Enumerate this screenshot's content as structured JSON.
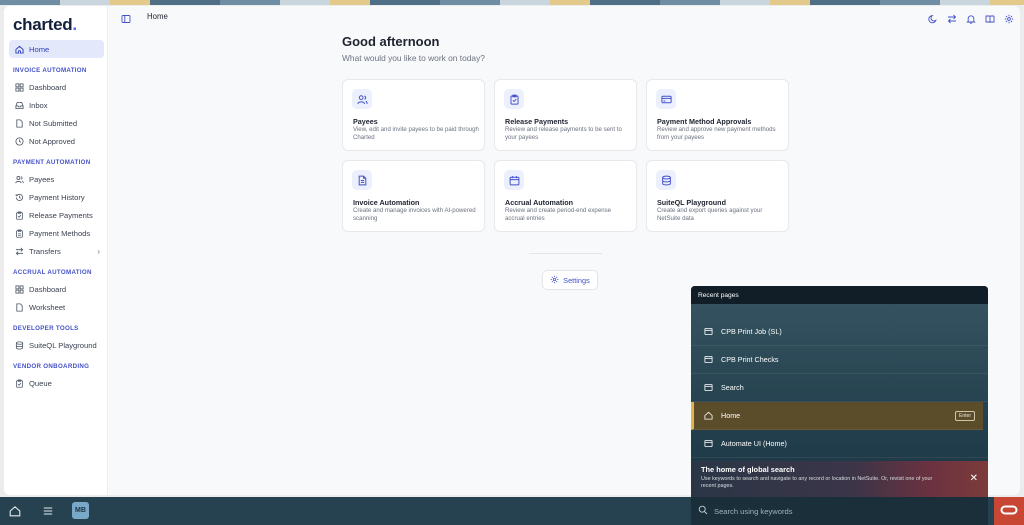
{
  "app": {
    "logo_text": "charted",
    "logo_dot": "."
  },
  "sidebar": {
    "home": "Home",
    "sections": [
      {
        "title": "INVOICE AUTOMATION",
        "items": [
          "Dashboard",
          "Inbox",
          "Not Submitted",
          "Not Approved"
        ]
      },
      {
        "title": "PAYMENT AUTOMATION",
        "items": [
          "Payees",
          "Payment History",
          "Release Payments",
          "Payment Methods",
          "Transfers"
        ]
      },
      {
        "title": "ACCRUAL AUTOMATION",
        "items": [
          "Dashboard",
          "Worksheet"
        ]
      },
      {
        "title": "DEVELOPER TOOLS",
        "items": [
          "SuiteQL Playground"
        ]
      },
      {
        "title": "VENDOR ONBOARDING",
        "items": [
          "Queue"
        ]
      }
    ]
  },
  "topbar": {
    "breadcrumb": "Home"
  },
  "main": {
    "greeting": "Good afternoon",
    "subtitle": "What would you like to work on today?",
    "cards": [
      {
        "title": "Payees",
        "desc": "View, edit and invite payees to be paid through Charted",
        "icon": "users-icon"
      },
      {
        "title": "Release Payments",
        "desc": "Review and release payments to be sent to your payees",
        "icon": "clipboard-check-icon"
      },
      {
        "title": "Payment Method Approvals",
        "desc": "Review and approve new payment methods from your payees",
        "icon": "credit-card-icon"
      },
      {
        "title": "Invoice Automation",
        "desc": "Create and manage invoices with AI-powered scanning",
        "icon": "document-icon"
      },
      {
        "title": "Accrual Automation",
        "desc": "Review and create period-end expense accrual entries",
        "icon": "calendar-icon"
      },
      {
        "title": "SuiteQL Playground",
        "desc": "Create and export queries against your NetSuite data",
        "icon": "database-icon"
      }
    ],
    "settings_label": "Settings"
  },
  "netsuite": {
    "recent_title": "Recent pages",
    "recent": [
      {
        "label": "CPB Print Job (SL)",
        "icon": "page-icon"
      },
      {
        "label": "CPB Print Checks",
        "icon": "page-icon"
      },
      {
        "label": "Search",
        "icon": "page-icon"
      },
      {
        "label": "Home",
        "icon": "home-icon",
        "badge": "Enter"
      },
      {
        "label": "Automate UI (Home)",
        "icon": "page-icon"
      }
    ],
    "banner_title": "The home of global search",
    "banner_desc": "Use keywords to search and navigate to any record or location in NetSuite. Or, revisit one of your recent pages.",
    "search_placeholder": "Search using keywords",
    "avatar_initials": "MB"
  },
  "colors": {
    "accent": "#4452c8",
    "active_nav_bg": "#e3e9fb",
    "bottom_bar": "#26414f",
    "highlight": "#e3b546",
    "oracle_red": "#c74634"
  }
}
